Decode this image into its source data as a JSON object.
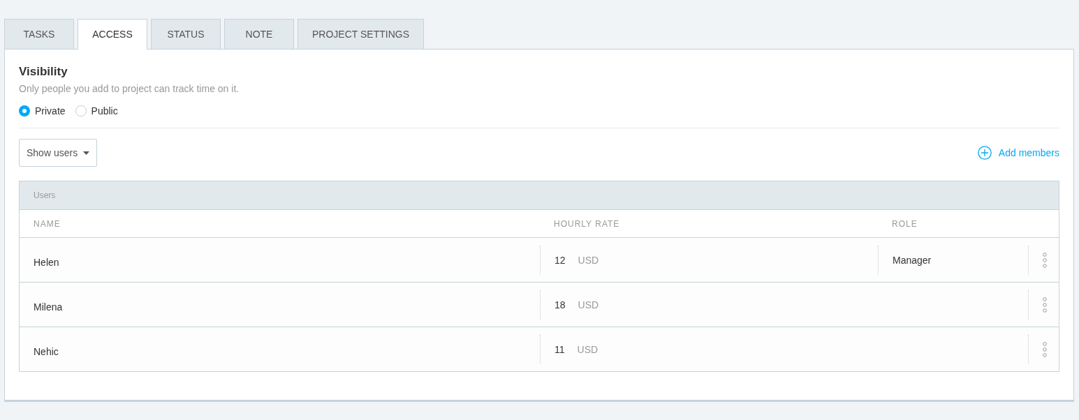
{
  "tabs": [
    {
      "label": "TASKS",
      "selected": false
    },
    {
      "label": "ACCESS",
      "selected": true
    },
    {
      "label": "STATUS",
      "selected": false
    },
    {
      "label": "NOTE",
      "selected": false
    },
    {
      "label": "PROJECT SETTINGS",
      "selected": false
    }
  ],
  "visibility": {
    "title": "Visibility",
    "description": "Only people you add to project can track time on it.",
    "options": [
      {
        "label": "Private",
        "selected": true
      },
      {
        "label": "Public",
        "selected": false
      }
    ]
  },
  "filter": {
    "label": "Show users"
  },
  "add_members": {
    "label": "Add members"
  },
  "users_table": {
    "title": "Users",
    "columns": [
      "NAME",
      "HOURLY RATE",
      "ROLE"
    ],
    "rows": [
      {
        "name": "Helen",
        "rate": "12",
        "currency": "USD",
        "role": "Manager"
      },
      {
        "name": "Milena",
        "rate": "18",
        "currency": "USD"
      },
      {
        "name": "Nehic",
        "rate": "11",
        "currency": "USD"
      }
    ]
  }
}
